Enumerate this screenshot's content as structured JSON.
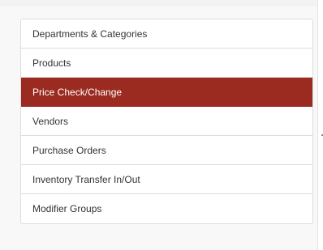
{
  "sidebar": {
    "items": [
      {
        "label": "Departments & Categories"
      },
      {
        "label": "Products"
      },
      {
        "label": "Price Check/Change"
      },
      {
        "label": "Vendors"
      },
      {
        "label": "Purchase Orders"
      },
      {
        "label": "Inventory Transfer In/Out"
      },
      {
        "label": "Modifier Groups"
      }
    ],
    "active_index": 2
  },
  "colors": {
    "active_background": "#9b2b21",
    "active_text": "#ffffff",
    "item_text": "#333333",
    "border": "#dddddd"
  }
}
